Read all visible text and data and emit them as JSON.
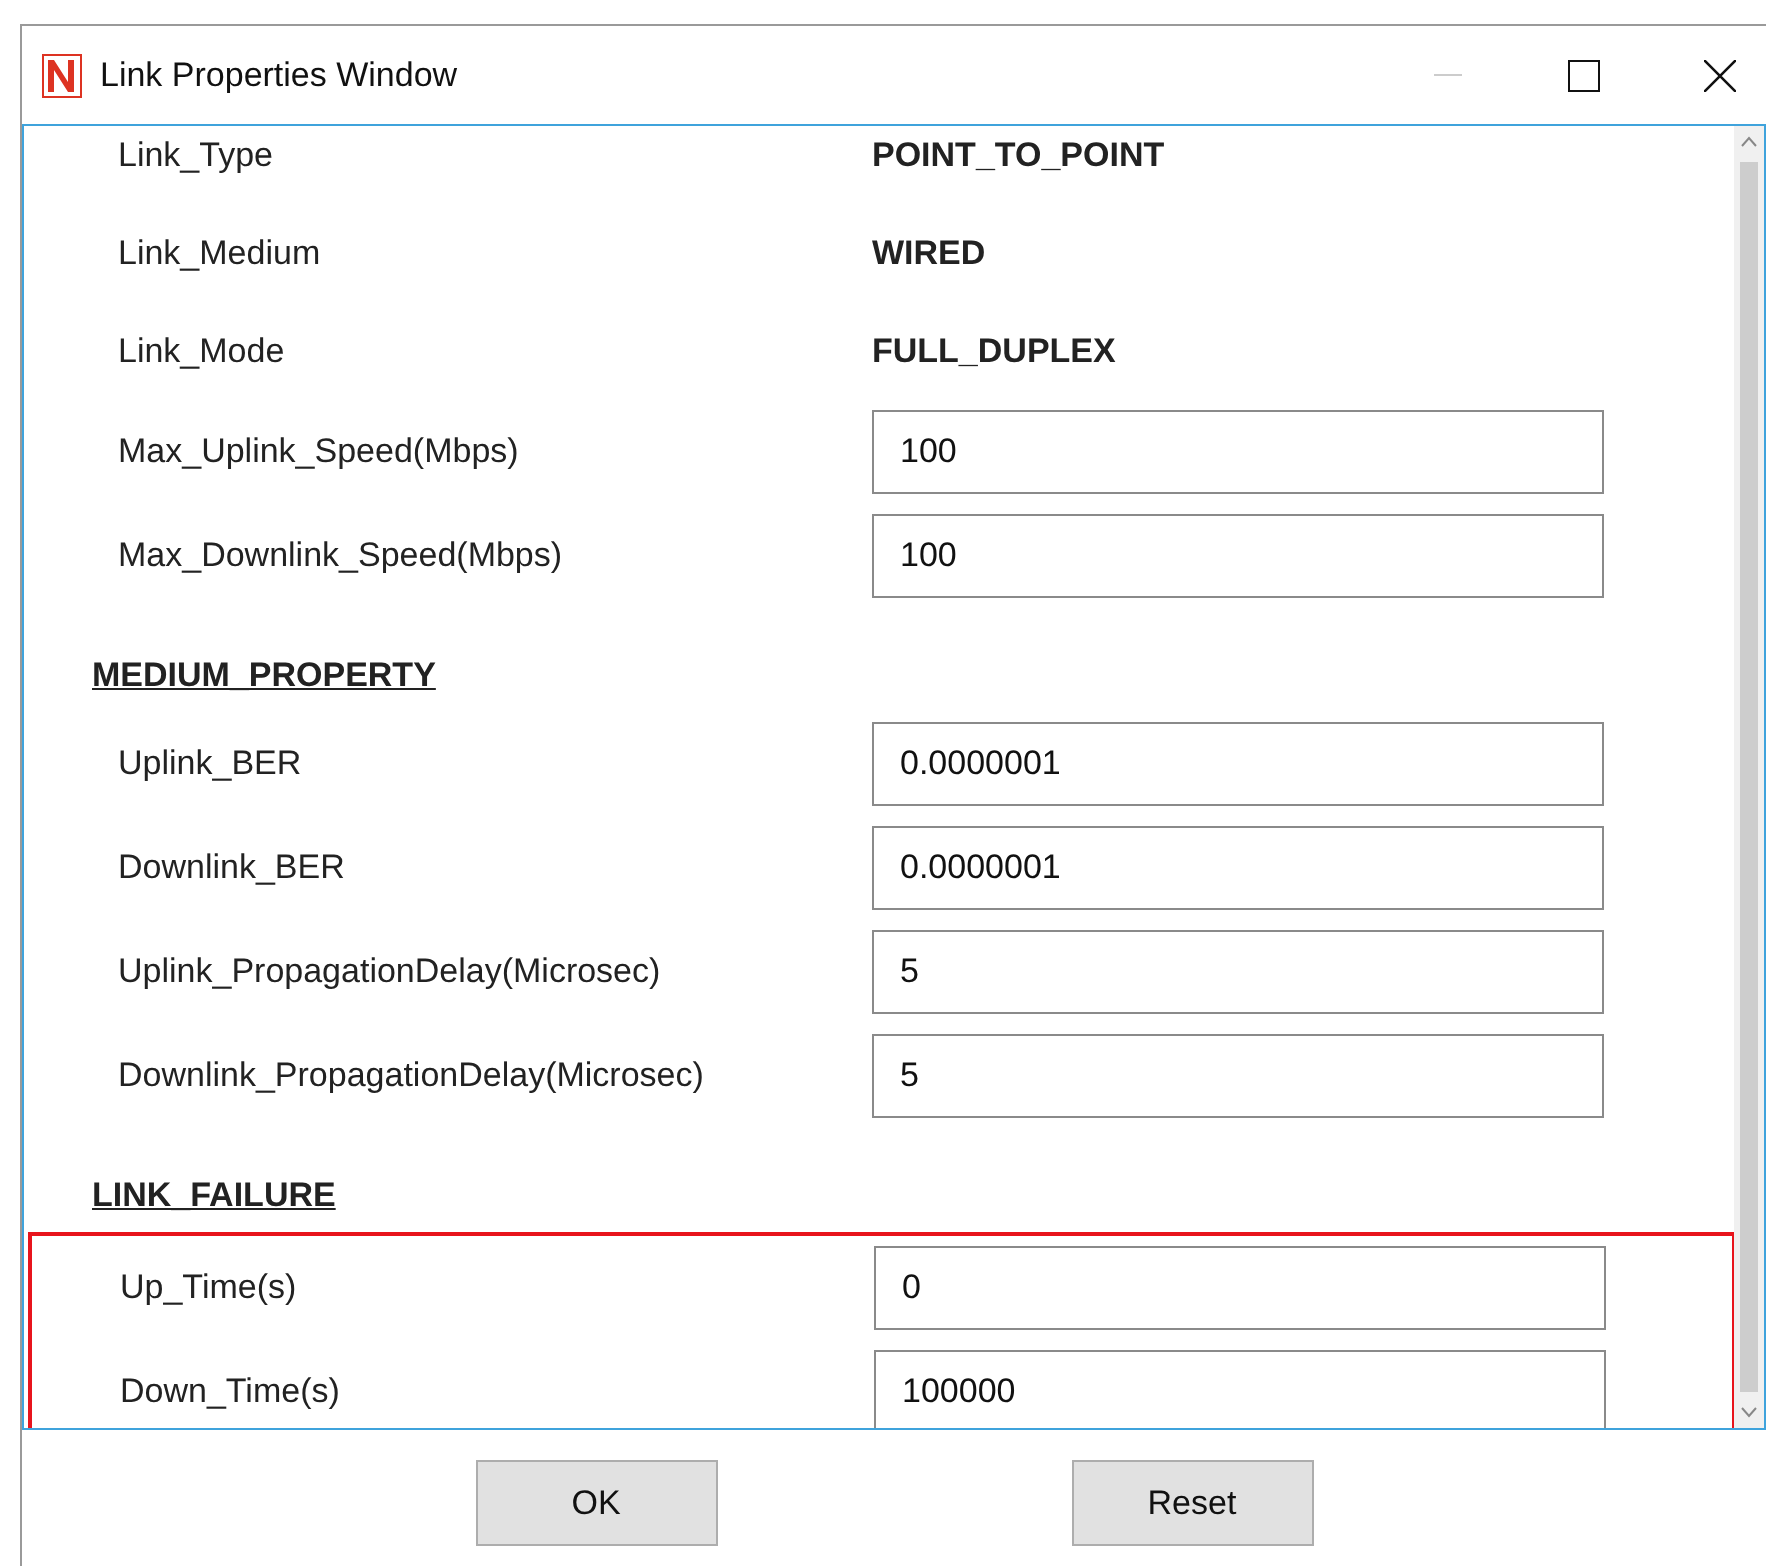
{
  "window": {
    "title": "Link Properties Window"
  },
  "sections": [
    {
      "highlighted": false,
      "rows": [
        {
          "kind": "static",
          "label": "Link_Type",
          "value": "POINT_TO_POINT"
        },
        {
          "kind": "static",
          "label": "Link_Medium",
          "value": "WIRED"
        },
        {
          "kind": "static",
          "label": "Link_Mode",
          "value": "FULL_DUPLEX"
        },
        {
          "kind": "input",
          "label": "Max_Uplink_Speed(Mbps)",
          "value": "100"
        },
        {
          "kind": "input",
          "label": "Max_Downlink_Speed(Mbps)",
          "value": "100"
        }
      ]
    },
    {
      "heading": "MEDIUM_PROPERTY",
      "highlighted": false,
      "rows": [
        {
          "kind": "input",
          "label": "Uplink_BER",
          "value": "0.0000001"
        },
        {
          "kind": "input",
          "label": "Downlink_BER",
          "value": "0.0000001"
        },
        {
          "kind": "input",
          "label": "Uplink_PropagationDelay(Microsec)",
          "value": "5"
        },
        {
          "kind": "input",
          "label": "Downlink_PropagationDelay(Microsec)",
          "value": "5"
        }
      ]
    },
    {
      "heading": "LINK_FAILURE",
      "highlighted": true,
      "rows": [
        {
          "kind": "input",
          "label": "Up_Time(s)",
          "value": "0"
        },
        {
          "kind": "input",
          "label": "Down_Time(s)",
          "value": "100000"
        }
      ]
    }
  ],
  "buttons": [
    "OK",
    "Reset"
  ]
}
